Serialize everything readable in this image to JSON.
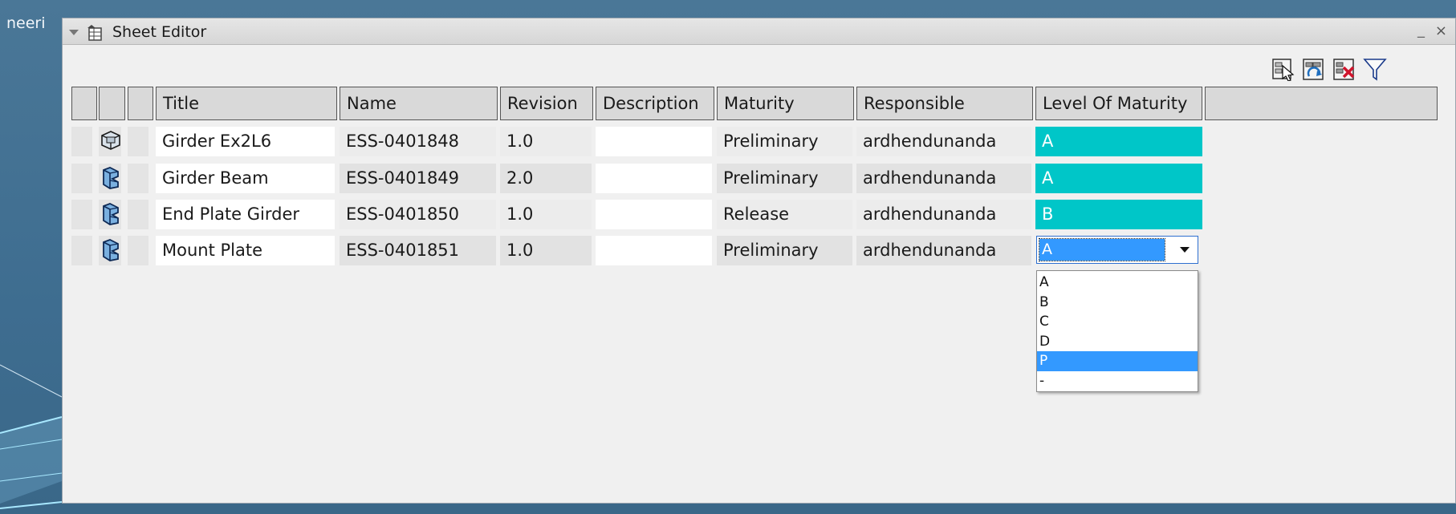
{
  "background_app": {
    "partial_text": "neeri"
  },
  "window": {
    "title": "Sheet Editor",
    "minimize_glyph": "_",
    "close_glyph": "×"
  },
  "toolbar": {
    "buttons": [
      {
        "icon": "select-in-tree-icon"
      },
      {
        "icon": "refresh-sheet-icon"
      },
      {
        "icon": "remove-rows-icon"
      },
      {
        "icon": "filter-icon"
      }
    ]
  },
  "table": {
    "columns": [
      "Title",
      "Name",
      "Revision",
      "Description",
      "Maturity",
      "Responsible",
      "Level Of Maturity"
    ],
    "rows": [
      {
        "icon": "product-icon",
        "title": "Girder Ex2L6",
        "name": "ESS-0401848",
        "revision": "1.0",
        "description": "",
        "maturity": "Preliminary",
        "responsible": "ardhendunanda",
        "level": "A"
      },
      {
        "icon": "part-icon",
        "title": "Girder Beam",
        "name": "ESS-0401849",
        "revision": "2.0",
        "description": "",
        "maturity": "Preliminary",
        "responsible": "ardhendunanda",
        "level": "A"
      },
      {
        "icon": "part-icon",
        "title": "End Plate Girder",
        "name": "ESS-0401850",
        "revision": "1.0",
        "description": "",
        "maturity": "Release",
        "responsible": "ardhendunanda",
        "level": "B"
      },
      {
        "icon": "part-icon",
        "title": "Mount Plate",
        "name": "ESS-0401851",
        "revision": "1.0",
        "description": "",
        "maturity": "Preliminary",
        "responsible": "ardhendunanda",
        "level": "A"
      }
    ]
  },
  "level_dropdown": {
    "selected": "A",
    "options": [
      "A",
      "B",
      "C",
      "D",
      "P",
      "-"
    ],
    "highlighted": "P"
  },
  "colors": {
    "level_cell": "#00c6c8",
    "selection": "#3399ff"
  }
}
